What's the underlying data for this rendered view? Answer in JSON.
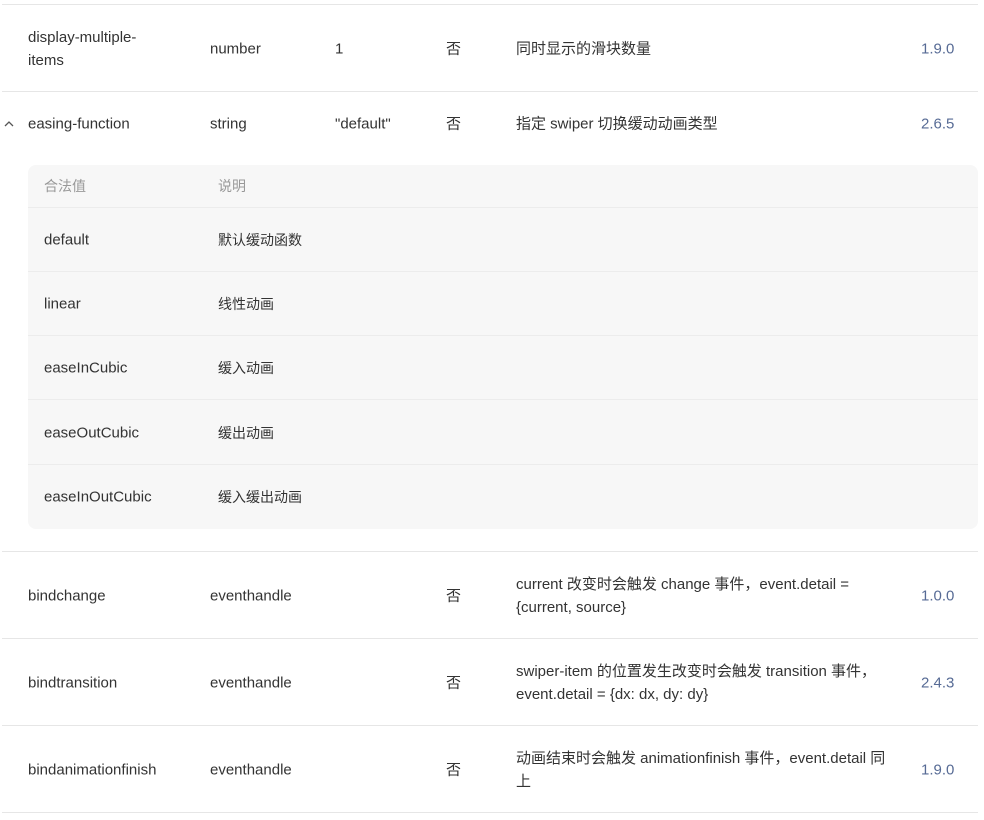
{
  "rows": [
    {
      "name": "display-multiple-\nitems",
      "type": "number",
      "default": "1",
      "required": "否",
      "desc": "同时显示的滑块数量",
      "version": "1.9.0"
    },
    {
      "name": "easing-function",
      "type": "string",
      "default": "\"default\"",
      "required": "否",
      "desc": "指定 swiper 切换缓动动画类型",
      "version": "2.6.5",
      "toggle_icon": "chevron-up-icon"
    },
    {
      "name": "bindchange",
      "type": "eventhandle",
      "default": "",
      "required": "否",
      "desc": "current 改变时会触发 change 事件，event.detail = {current, source}",
      "version": "1.0.0"
    },
    {
      "name": "bindtransition",
      "type": "eventhandle",
      "default": "",
      "required": "否",
      "desc": "swiper-item 的位置发生改变时会触发 transition 事件，event.detail = {dx: dx, dy: dy}",
      "version": "2.4.3"
    },
    {
      "name": "bindanimationfinish",
      "type": "eventhandle",
      "default": "",
      "required": "否",
      "desc": "动画结束时会触发 animationfinish 事件，event.detail 同上",
      "version": "1.9.0"
    }
  ],
  "easing_values": {
    "header": {
      "value": "合法值",
      "desc": "说明"
    },
    "items": [
      {
        "value": "default",
        "desc": "默认缓动函数"
      },
      {
        "value": "linear",
        "desc": "线性动画"
      },
      {
        "value": "easeInCubic",
        "desc": "缓入动画"
      },
      {
        "value": "easeOutCubic",
        "desc": "缓出动画"
      },
      {
        "value": "easeInOutCubic",
        "desc": "缓入缓出动画"
      }
    ]
  },
  "colors": {
    "version_link": "#576b95",
    "sub_bg": "#f7f7f7",
    "border": "#e6e6e6",
    "muted": "#999999"
  }
}
